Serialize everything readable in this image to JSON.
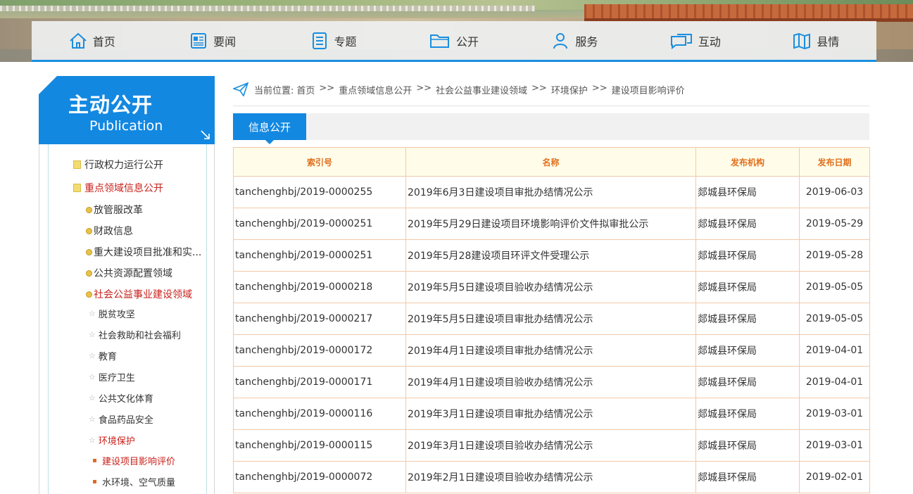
{
  "nav": [
    {
      "label": "首页",
      "icon": "home-icon"
    },
    {
      "label": "要闻",
      "icon": "newspaper-icon"
    },
    {
      "label": "专题",
      "icon": "document-icon"
    },
    {
      "label": "公开",
      "icon": "folder-icon"
    },
    {
      "label": "服务",
      "icon": "person-icon"
    },
    {
      "label": "互动",
      "icon": "chat-icon"
    },
    {
      "label": "县情",
      "icon": "map-icon"
    }
  ],
  "sidebar": {
    "title_zh": "主动公开",
    "title_en": "Publication",
    "items": [
      {
        "label": "行政权力运行公开",
        "level": 1,
        "active": false
      },
      {
        "label": "重点领域信息公开",
        "level": 1,
        "active": true
      },
      {
        "label": "放管服改革",
        "level": 2,
        "active": false
      },
      {
        "label": "财政信息",
        "level": 2,
        "active": false
      },
      {
        "label": "重大建设项目批准和实...",
        "level": 2,
        "active": false
      },
      {
        "label": "公共资源配置领域",
        "level": 2,
        "active": false
      },
      {
        "label": "社会公益事业建设领域",
        "level": 2,
        "active": true
      },
      {
        "label": "脱贫攻坚",
        "level": 3,
        "active": false
      },
      {
        "label": "社会救助和社会福利",
        "level": 3,
        "active": false
      },
      {
        "label": "教育",
        "level": 3,
        "active": false
      },
      {
        "label": "医疗卫生",
        "level": 3,
        "active": false
      },
      {
        "label": "公共文化体育",
        "level": 3,
        "active": false
      },
      {
        "label": "食品药品安全",
        "level": 3,
        "active": false
      },
      {
        "label": "环境保护",
        "level": 3,
        "active": true
      },
      {
        "label": "建设项目影响评价",
        "level": 4,
        "active": true
      },
      {
        "label": "水环境、空气质量",
        "level": 4,
        "active": false
      }
    ]
  },
  "breadcrumb": {
    "prefix": "当前位置:",
    "items": [
      "首页",
      "重点领域信息公开",
      "社会公益事业建设领域",
      "环境保护",
      "建设项目影响评价"
    ],
    "separator": ">>"
  },
  "tab": {
    "label": "信息公开"
  },
  "table": {
    "headers": [
      "索引号",
      "名称",
      "发布机构",
      "发布日期"
    ],
    "rows": [
      [
        "tanchenghbj/2019-0000255",
        "2019年6月3日建设项目审批办结情况公示",
        "郯城县环保局",
        "2019-06-03"
      ],
      [
        "tanchenghbj/2019-0000251",
        "2019年5月29日建设项目环境影响评价文件拟审批公示",
        "郯城县环保局",
        "2019-05-29"
      ],
      [
        "tanchenghbj/2019-0000251",
        "2019年5月28建设项目环评文件受理公示",
        "郯城县环保局",
        "2019-05-28"
      ],
      [
        "tanchenghbj/2019-0000218",
        "2019年5月5日建设项目验收办结情况公示",
        "郯城县环保局",
        "2019-05-05"
      ],
      [
        "tanchenghbj/2019-0000217",
        "2019年5月5日建设项目审批办结情况公示",
        "郯城县环保局",
        "2019-05-05"
      ],
      [
        "tanchenghbj/2019-0000172",
        "2019年4月1日建设项目审批办结情况公示",
        "郯城县环保局",
        "2019-04-01"
      ],
      [
        "tanchenghbj/2019-0000171",
        "2019年4月1日建设项目验收办结情况公示",
        "郯城县环保局",
        "2019-04-01"
      ],
      [
        "tanchenghbj/2019-0000116",
        "2019年3月1日建设项目审批办结情况公示",
        "郯城县环保局",
        "2019-03-01"
      ],
      [
        "tanchenghbj/2019-0000115",
        "2019年3月1日建设项目验收办结情况公示",
        "郯城县环保局",
        "2019-03-01"
      ],
      [
        "tanchenghbj/2019-0000072",
        "2019年2月1日建设项目验收办结情况公示",
        "郯城县环保局",
        "2019-02-01"
      ]
    ]
  },
  "colors": {
    "accent": "#1388e1",
    "active_text": "#c8211b",
    "header_text": "#e0701f",
    "table_border": "#f2c9a7",
    "header_bg": "#fffde9"
  }
}
